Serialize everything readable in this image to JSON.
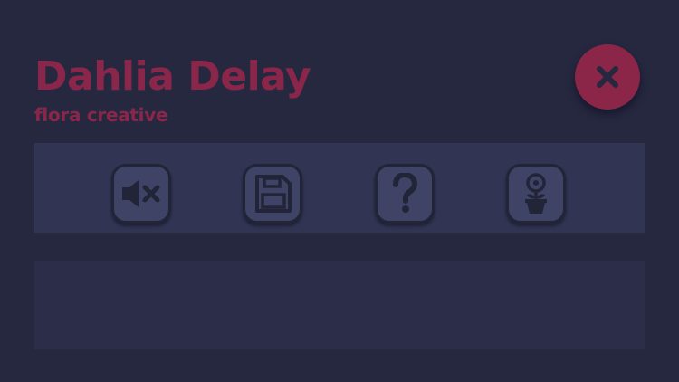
{
  "header": {
    "title": "Dahlia Delay",
    "subtitle": "flora creative"
  },
  "toolbar": {
    "buttons": [
      {
        "name": "mute-button",
        "icon": "speaker-muted-icon"
      },
      {
        "name": "save-button",
        "icon": "floppy-disk-icon"
      },
      {
        "name": "help-button",
        "icon": "question-mark-icon"
      },
      {
        "name": "flower-button",
        "icon": "potted-flower-icon"
      }
    ]
  },
  "close_button": {
    "icon": "close-icon"
  },
  "colors": {
    "background": "#262840",
    "accent": "#8b2649",
    "toolbar": "#313452",
    "button_face": "#3f4466",
    "button_border": "#222438",
    "icon": "#222438",
    "panel": "#2c2e49"
  }
}
